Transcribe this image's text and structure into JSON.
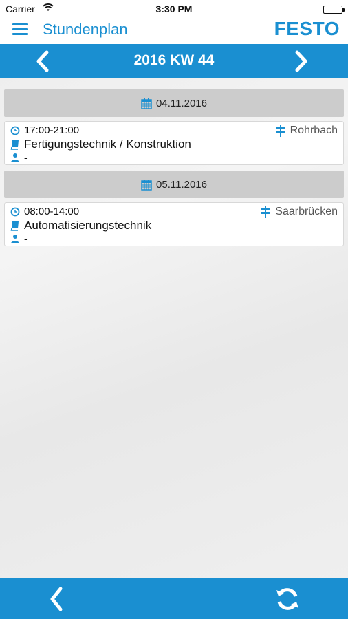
{
  "status_bar": {
    "carrier": "Carrier",
    "time": "3:30 PM"
  },
  "nav": {
    "title": "Stundenplan",
    "logo": "FESTO",
    "menu_icon": "hamburger-icon"
  },
  "week": {
    "label": "2016 KW 44",
    "prev_icon": "chevron-left-icon",
    "next_icon": "chevron-right-icon"
  },
  "days": [
    {
      "date": "04.11.2016",
      "entries": [
        {
          "time": "17:00-21:00",
          "course": "Fertigungstechnik / Konstruktion",
          "lecturer": "-",
          "location": "Rohrbach"
        }
      ]
    },
    {
      "date": "05.11.2016",
      "entries": [
        {
          "time": "08:00-14:00",
          "course": "Automatisierungstechnik",
          "lecturer": "-",
          "location": "Saarbrücken"
        }
      ]
    }
  ],
  "bottom_bar": {
    "back_icon": "chevron-left-icon",
    "refresh_icon": "refresh-icon"
  },
  "colors": {
    "accent": "#1a8fd1",
    "day_header_bg": "#cccccc"
  }
}
